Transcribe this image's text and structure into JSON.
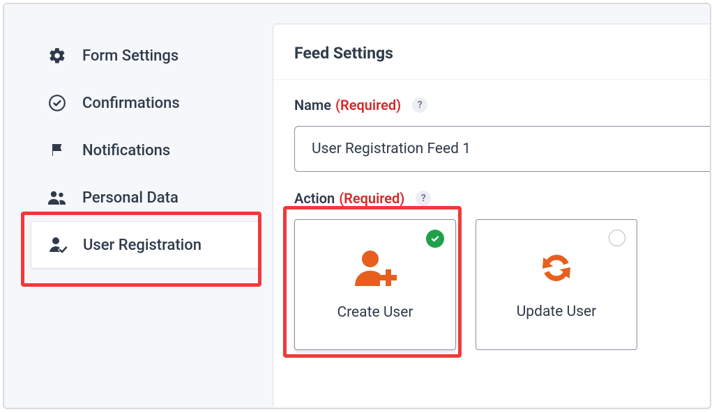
{
  "sidebar": {
    "items": [
      {
        "label": "Form Settings"
      },
      {
        "label": "Confirmations"
      },
      {
        "label": "Notifications"
      },
      {
        "label": "Personal Data"
      },
      {
        "label": "User Registration"
      }
    ]
  },
  "panel": {
    "title": "Feed Settings",
    "name_label": "Name",
    "action_label": "Action",
    "required_text": "(Required)",
    "help_glyph": "?",
    "name_value": "User Registration Feed 1",
    "actions": [
      {
        "label": "Create User",
        "selected": true
      },
      {
        "label": "Update User",
        "selected": false
      }
    ]
  }
}
